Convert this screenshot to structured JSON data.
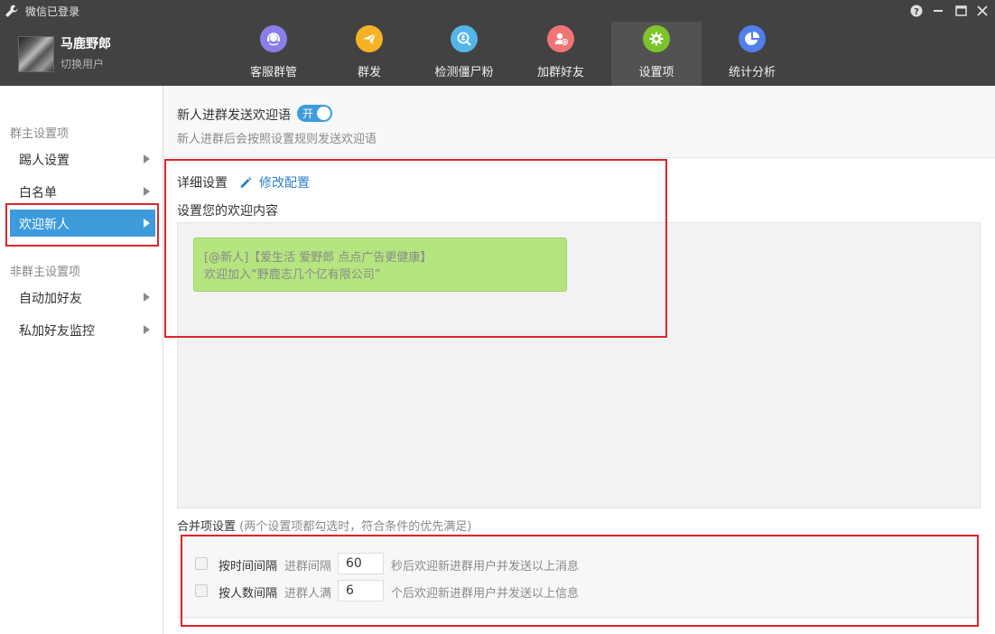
{
  "window": {
    "title": "微信已登录",
    "controls": [
      "help-icon",
      "minimize-icon",
      "maximize-icon",
      "close-icon"
    ]
  },
  "user": {
    "name": "马鹿野郎",
    "switch_label": "切换用户"
  },
  "nav": {
    "tabs": [
      {
        "label": "客服群管",
        "icon": "headset-icon",
        "color": "#8a7fe8"
      },
      {
        "label": "群发",
        "icon": "paper-plane-icon",
        "color": "#f5b324"
      },
      {
        "label": "检测僵尸粉",
        "icon": "search-user-icon",
        "color": "#52b6e8"
      },
      {
        "label": "加群好友",
        "icon": "add-user-icon",
        "color": "#ef7474"
      },
      {
        "label": "设置项",
        "icon": "gear-icon",
        "color": "#7dc42c",
        "active": true
      },
      {
        "label": "统计分析",
        "icon": "pie-chart-icon",
        "color": "#4f7fe8"
      }
    ]
  },
  "sidebar": {
    "section1": "群主设置项",
    "section2": "非群主设置项",
    "items": [
      {
        "label": "踢人设置"
      },
      {
        "label": "白名单"
      },
      {
        "label": "欢迎新人",
        "active": true
      },
      {
        "label": "自动加好友"
      },
      {
        "label": "私加好友监控"
      }
    ]
  },
  "welcome": {
    "title": "新人进群发送欢迎语",
    "toggle_label": "开",
    "toggle_on": true,
    "description": "新人进群后会按照设置规则发送欢迎语"
  },
  "detail": {
    "title": "详细设置",
    "edit_label": "修改配置",
    "content_title": "设置您的欢迎内容",
    "bubble_line1": "[@新人]【爱生活 爱野郎 点点广告更健康】",
    "bubble_line2": "欢迎加入“野鹿志几个亿有限公司”"
  },
  "merge": {
    "title": "合并项设置",
    "note": "(两个设置项都勾选时，符合条件的优先满足)",
    "options": [
      {
        "label": "按时间间隔",
        "sub": "进群间隔",
        "value": "60",
        "tail": "秒后欢迎新进群用户并发送以上消息",
        "checked": false
      },
      {
        "label": "按人数间隔",
        "sub": "进群人满",
        "value": "6",
        "tail": "个后欢迎新进群用户并发送以上信息",
        "checked": false
      }
    ]
  },
  "colors": {
    "accent": "#3d9bdb",
    "header_bg": "#424242",
    "highlight_box": "#e0232b",
    "bubble_bg": "#b4e57f"
  }
}
